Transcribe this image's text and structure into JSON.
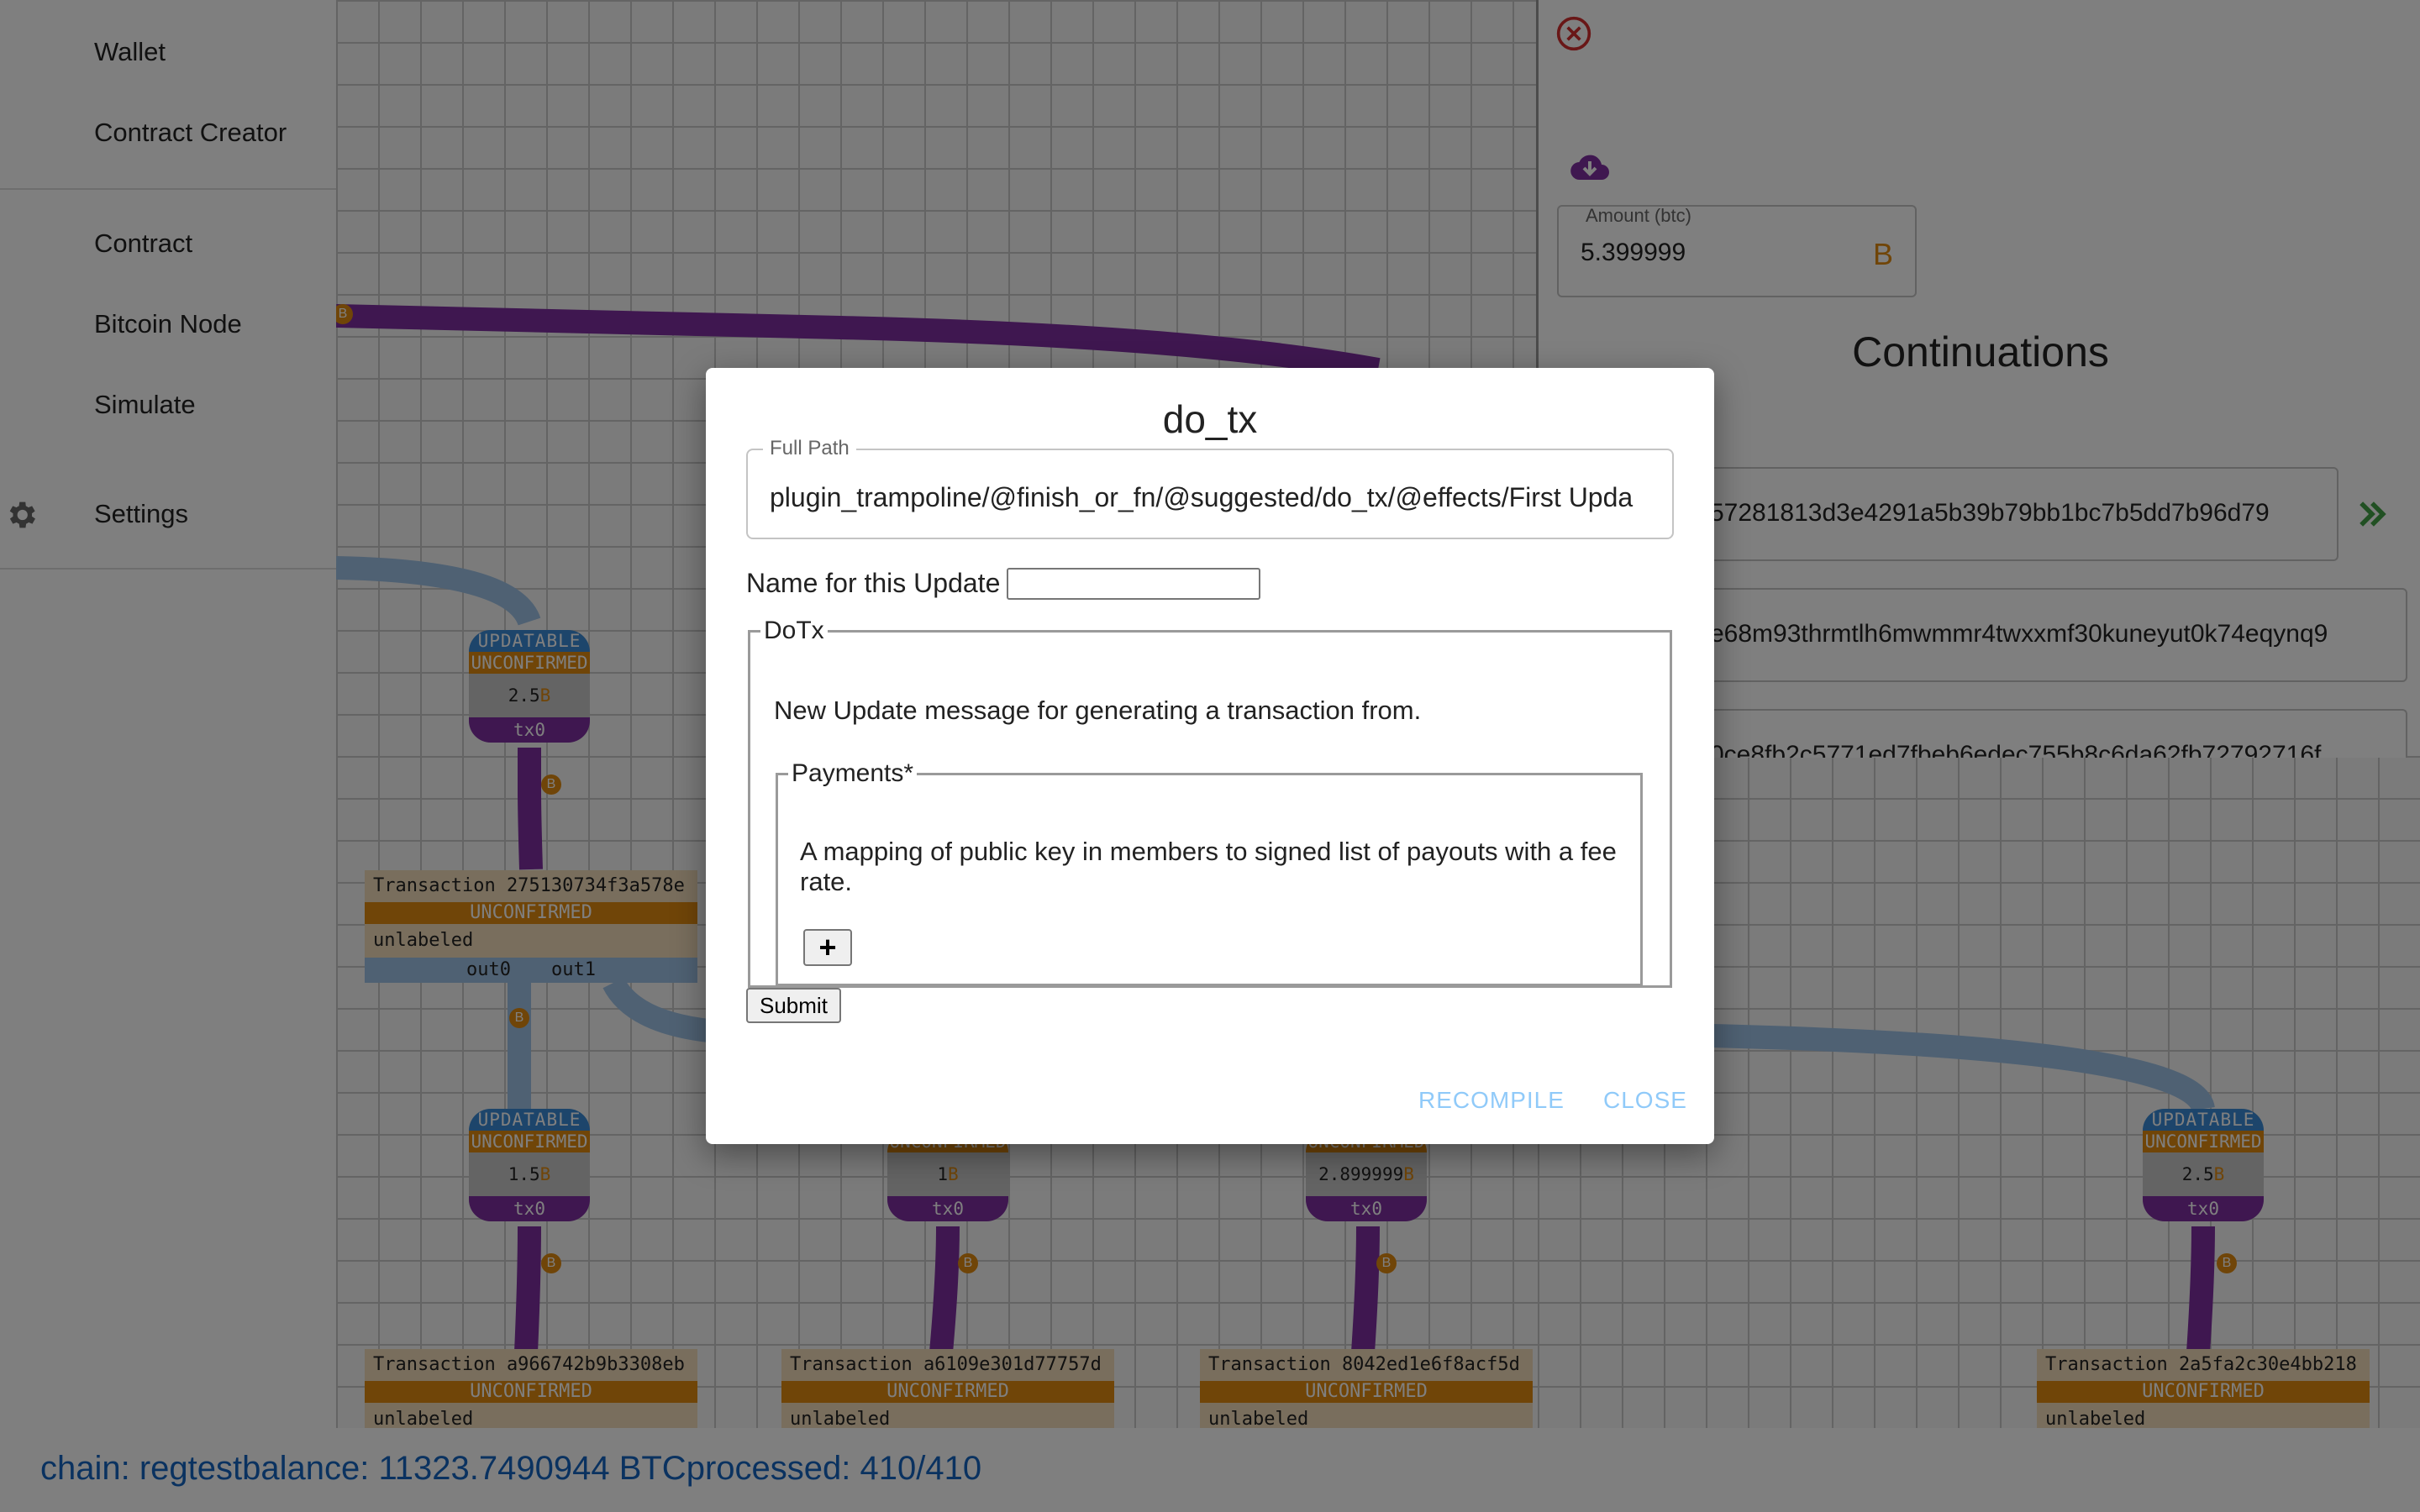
{
  "sidebar": {
    "items": [
      {
        "label": "Wallet"
      },
      {
        "label": "Contract Creator"
      },
      {
        "label": "Contract"
      },
      {
        "label": "Bitcoin Node"
      },
      {
        "label": "Simulate"
      },
      {
        "label": "Settings",
        "icon": "gear-icon"
      }
    ]
  },
  "graph": {
    "btc_symbol": "B",
    "nodes": [
      {
        "status": "UPDATABLE",
        "confirm": "UNCONFIRMED",
        "amount": "2.5",
        "tx": "tx0"
      },
      {
        "status": "UPDATABLE",
        "confirm": "UNCONFIRMED",
        "amount": "1.5",
        "tx": "tx0"
      },
      {
        "status": "",
        "confirm": "UNCONFIRMED",
        "amount": "1",
        "tx": "tx0"
      },
      {
        "status": "",
        "confirm": "UNCONFIRMED",
        "amount": "2.899999",
        "tx": "tx0"
      },
      {
        "status": "UPDATABLE",
        "confirm": "UNCONFIRMED",
        "amount": "2.5",
        "tx": "tx0"
      }
    ],
    "transactions": [
      {
        "title": "Transaction  275130734f3a578e",
        "status": "UNCONFIRMED",
        "label": "unlabeled",
        "out0": "out0",
        "out1": "out1"
      },
      {
        "title": "Transaction  a966742b9b3308eb",
        "status": "UNCONFIRMED",
        "label": "unlabeled"
      },
      {
        "title": "Transaction  a6109e301d77757d",
        "status": "UNCONFIRMED",
        "label": "unlabeled"
      },
      {
        "title": "Transaction  8042ed1e6f8acf5d",
        "status": "UNCONFIRMED",
        "label": "unlabeled"
      },
      {
        "title": "Transaction  2a5fa2c30e4bb218",
        "status": "UNCONFIRMED",
        "label": "unlabeled"
      }
    ]
  },
  "right_panel": {
    "amount_label": "Amount (btc)",
    "amount_value": "5.399999",
    "continuations_title": "Continuations",
    "continuations": [
      "57281813d3e4291a5b39b79bb1bc7b5dd7b96d79",
      "e68m93thrmtlh6mwmmr4twxxmf30kuneyut0k74eqynq9",
      "0ce8fb2c5771ed7fbeb6edec755b8c6da62fb72792716f"
    ]
  },
  "status_bar": {
    "text": "chain: regtestbalance: 11323.7490944 BTCprocessed: 410/410"
  },
  "dialog": {
    "title": "do_tx",
    "full_path_label": "Full Path",
    "full_path_value": "plugin_trampoline/@finish_or_fn/@suggested/do_tx/@effects/First Upda",
    "name_label": "Name for this Update",
    "name_value": "",
    "dotx_legend": "DoTx",
    "dotx_desc": "New Update message for generating a transaction from.",
    "payments_legend": "Payments*",
    "payments_desc": "A mapping of public key in members to signed list of payouts with a fee rate.",
    "add_label": "+",
    "submit_label": "Submit",
    "recompile_label": "RECOMPILE",
    "close_label": "CLOSE"
  }
}
